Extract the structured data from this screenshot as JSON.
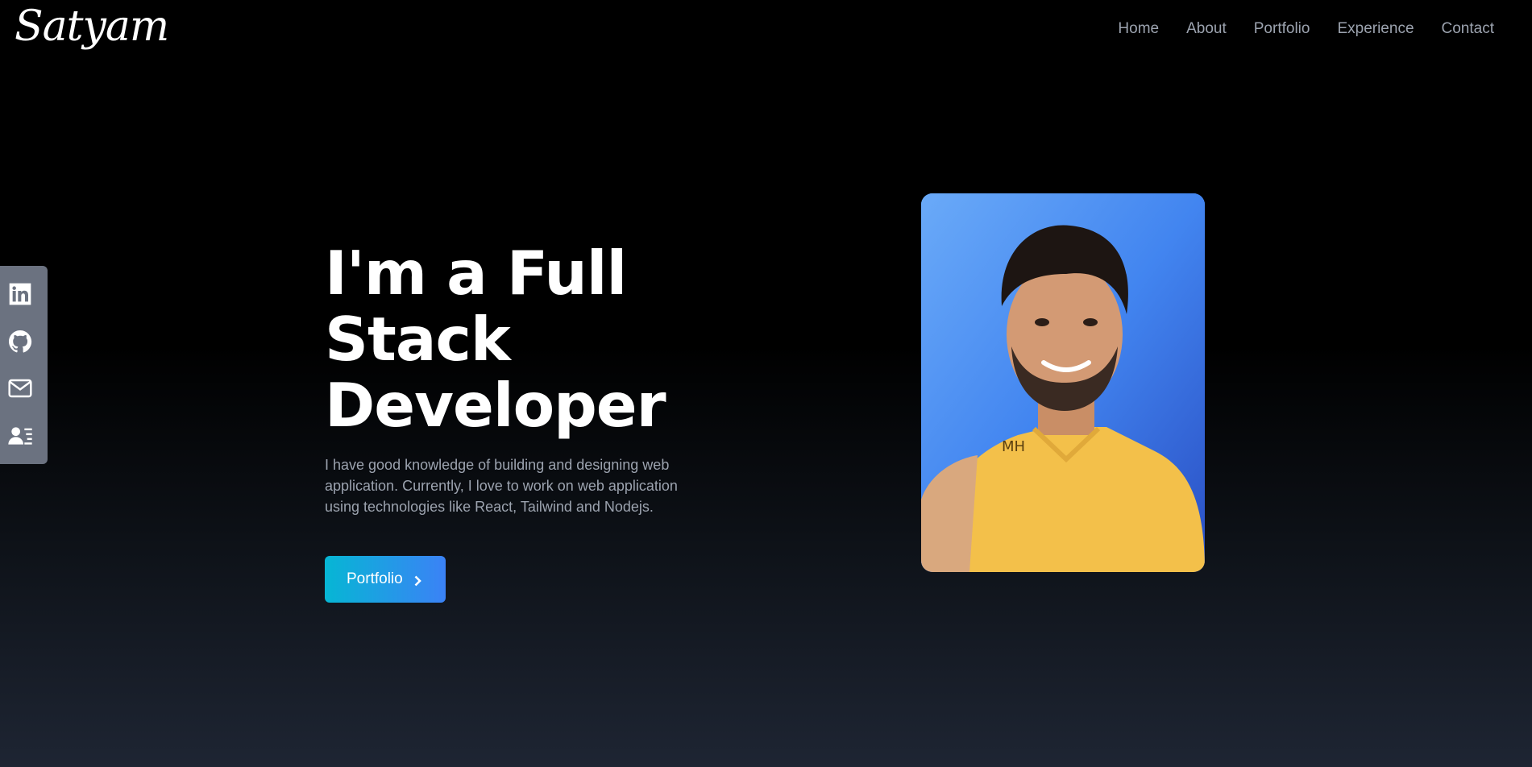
{
  "brand": {
    "logo_text": "Satyam"
  },
  "nav": {
    "items": [
      {
        "label": "Home"
      },
      {
        "label": "About"
      },
      {
        "label": "Portfolio"
      },
      {
        "label": "Experience"
      },
      {
        "label": "Contact"
      }
    ]
  },
  "social": {
    "items": [
      {
        "icon": "linkedin-icon"
      },
      {
        "icon": "github-icon"
      },
      {
        "icon": "mail-icon"
      },
      {
        "icon": "resume-icon"
      }
    ]
  },
  "hero": {
    "title": "I'm a Full Stack Developer",
    "description": "I have good knowledge of building and designing web application. Currently, I love to work on web application using technologies like React, Tailwind and Nodejs.",
    "cta_label": "Portfolio",
    "cta_icon": "chevron-right-icon"
  },
  "profile": {
    "image": "profile-photo"
  },
  "colors": {
    "background_top": "#000000",
    "background_bottom": "#1e2533",
    "nav_text": "#9ca3af",
    "social_bar": "#6b7280",
    "cta_gradient_start": "#06b6d4",
    "cta_gradient_end": "#3b82f6"
  }
}
